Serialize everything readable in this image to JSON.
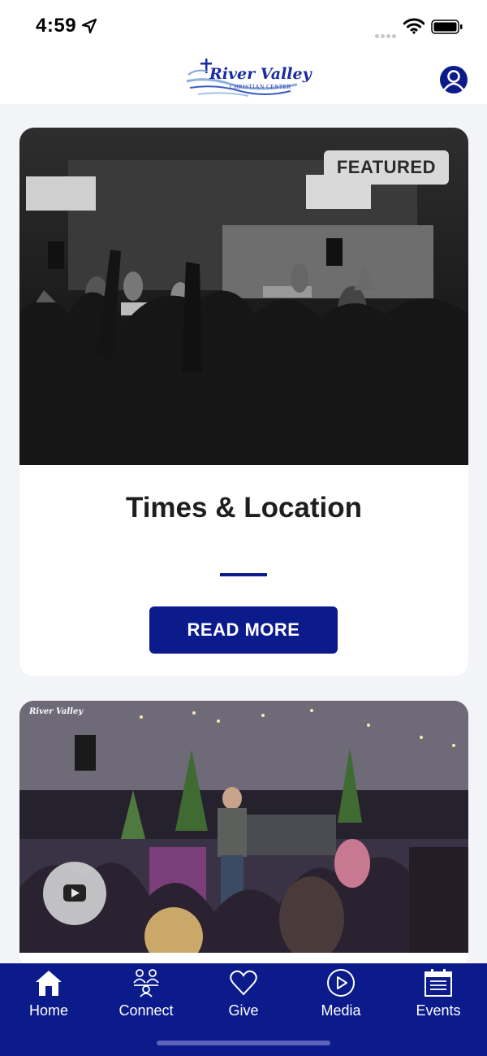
{
  "status_bar": {
    "time": "4:59"
  },
  "header": {
    "logo_title": "River Valley",
    "logo_subtitle": "CHRISTIAN CENTER",
    "profile_icon": "person-circle-icon"
  },
  "feed": {
    "featured_card": {
      "badge": "FEATURED",
      "title": "Times & Location",
      "button_label": "READ MORE"
    },
    "video_card": {
      "watermark": "River Valley",
      "play_icon": "youtube-play-icon"
    }
  },
  "bottom_nav": {
    "items": [
      {
        "label": "Home",
        "icon": "home-icon"
      },
      {
        "label": "Connect",
        "icon": "people-icon"
      },
      {
        "label": "Give",
        "icon": "heart-icon"
      },
      {
        "label": "Media",
        "icon": "play-circle-icon"
      },
      {
        "label": "Events",
        "icon": "calendar-icon"
      }
    ]
  },
  "colors": {
    "brand_blue": "#0c1b8b",
    "badge_gray": "#d9d9d9"
  }
}
